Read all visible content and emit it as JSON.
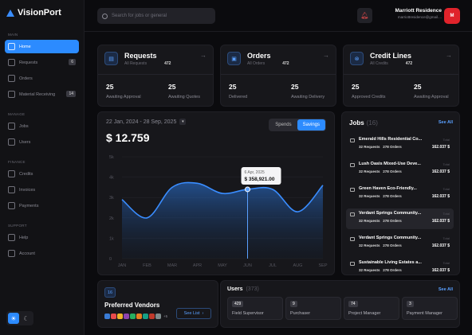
{
  "app": {
    "name": "VisionPort"
  },
  "search": {
    "placeholder": "Search for jobs or general"
  },
  "user": {
    "name": "Marriott Residence",
    "email": "marriottresidence@gmail....",
    "avatar_text": "M"
  },
  "sidebar": {
    "main_label": "MAIN",
    "main_items": [
      {
        "label": "Home",
        "icon": "home-icon",
        "active": true
      },
      {
        "label": "Requests",
        "icon": "requests-icon",
        "badge": "6"
      },
      {
        "label": "Orders",
        "icon": "orders-icon"
      },
      {
        "label": "Material Receiving",
        "icon": "receiving-icon",
        "badge": "14"
      }
    ],
    "manage_label": "MANAGE",
    "manage_items": [
      {
        "label": "Jobs",
        "icon": "jobs-icon"
      },
      {
        "label": "Users",
        "icon": "users-icon"
      }
    ],
    "finance_label": "FINANCE",
    "finance_items": [
      {
        "label": "Credits",
        "icon": "credits-icon"
      },
      {
        "label": "Invoices",
        "icon": "invoices-icon"
      },
      {
        "label": "Payments",
        "icon": "payments-icon"
      }
    ],
    "support_label": "SUPPORT",
    "support_items": [
      {
        "label": "Help",
        "icon": "help-icon"
      },
      {
        "label": "Account",
        "icon": "account-icon"
      }
    ]
  },
  "stats": [
    {
      "title": "Requests",
      "sub": "All Requests",
      "count": "472",
      "a_num": "25",
      "a_label": "Awaiting Approval",
      "b_num": "25",
      "b_label": "Awaiting Quotes"
    },
    {
      "title": "Orders",
      "sub": "All Orders",
      "count": "472",
      "a_num": "25",
      "a_label": "Delivered",
      "b_num": "25",
      "b_label": "Awaiting Delivery"
    },
    {
      "title": "Credit Lines",
      "sub": "All Credits",
      "count": "472",
      "a_num": "25",
      "a_label": "Approved Credits",
      "b_num": "25",
      "b_label": "Awaiting Approval"
    }
  ],
  "spend": {
    "range": "22 Jan, 2024 - 28 Sep, 2025",
    "total": "$ 12.759",
    "tab_spends": "Spends",
    "tab_savings": "Savings",
    "tooltip_date": "6 Apr, 2025",
    "tooltip_value": "$ 358,921.00"
  },
  "chart_data": {
    "type": "area",
    "x": [
      "JAN",
      "FEB",
      "MAR",
      "APR",
      "MAY",
      "JUN",
      "JUL",
      "AUG",
      "SEP"
    ],
    "y_ticks": [
      "0",
      "1k",
      "2k",
      "3k",
      "4k",
      "5k"
    ],
    "ylim": [
      0,
      5000
    ],
    "series": [
      {
        "values": [
          2900,
          2000,
          3500,
          3700,
          3200,
          3400,
          3400,
          2300,
          3600
        ]
      }
    ],
    "grid": true,
    "highlight": {
      "x": "JUN"
    }
  },
  "jobs": {
    "title": "Jobs",
    "count": "(16)",
    "see_all": "See All",
    "total_label": "Total",
    "items": [
      {
        "name": "Emerald Hills Residential Co...",
        "requests": "32 Requests",
        "orders": "278 Orders",
        "total": "162.037 $"
      },
      {
        "name": "Lush Oasis Mixed-Use Deve...",
        "requests": "32 Requests",
        "orders": "278 Orders",
        "total": "162.037 $"
      },
      {
        "name": "Green Haven Eco-Friendly...",
        "requests": "32 Requests",
        "orders": "278 Orders",
        "total": "162.037 $"
      },
      {
        "name": "Verdant Springs Community...",
        "requests": "32 Requests",
        "orders": "278 Orders",
        "total": "162.037 $",
        "selected": true
      },
      {
        "name": "Verdant Springs Community...",
        "requests": "32 Requests",
        "orders": "278 Orders",
        "total": "162.037 $"
      },
      {
        "name": "Sustainable Living Estates a...",
        "requests": "32 Requests",
        "orders": "278 Orders",
        "total": "162.037 $"
      }
    ]
  },
  "vendors": {
    "count": "16",
    "title": "Preferred Vendors",
    "more": "+5",
    "see_list": "See List",
    "chip_colors": [
      "#3a7bd5",
      "#e94b4b",
      "#f0b429",
      "#8e44ad",
      "#27ae60",
      "#e67e22",
      "#16a085",
      "#c0392b",
      "#7f8c8d"
    ]
  },
  "users": {
    "title": "Users",
    "count": "(373)",
    "see_all": "See All",
    "roles": [
      {
        "count": "429",
        "label": "Field Supervisor"
      },
      {
        "count": "9",
        "label": "Purchaser"
      },
      {
        "count": "74",
        "label": "Project Manager"
      },
      {
        "count": "3",
        "label": "Payment Manager"
      }
    ]
  }
}
